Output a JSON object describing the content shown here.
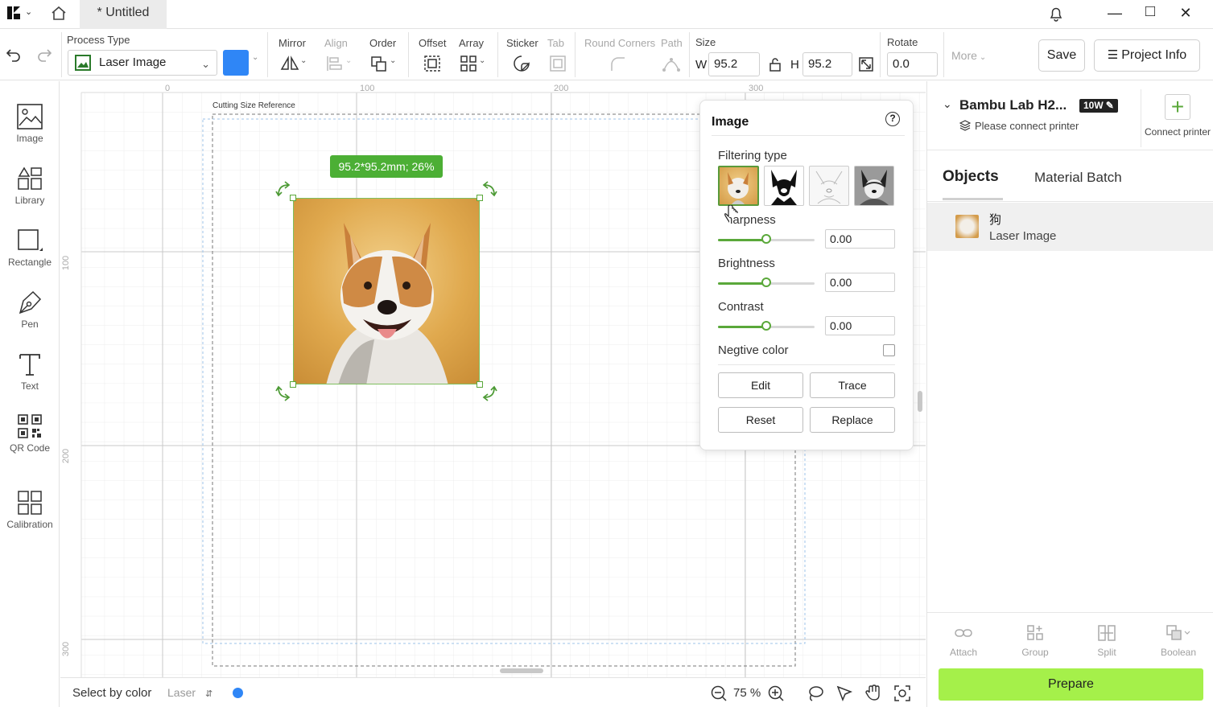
{
  "titlebar": {
    "tab_title": "* Untitled"
  },
  "toolbar": {
    "process_type_label": "Process Type",
    "process_type_value": "Laser Image",
    "mirror": "Mirror",
    "align": "Align",
    "order": "Order",
    "offset": "Offset",
    "array": "Array",
    "sticker": "Sticker",
    "tab": "Tab",
    "round_corners": "Round Corners",
    "path": "Path",
    "size": "Size",
    "w_label": "W",
    "w_value": "95.2",
    "h_label": "H",
    "h_value": "95.2",
    "rotate": "Rotate",
    "rotate_value": "0.0",
    "more": "More",
    "save": "Save",
    "project_info": "Project Info",
    "color": "#2f86f6"
  },
  "left_tools": [
    {
      "label": "Image"
    },
    {
      "label": "Library"
    },
    {
      "label": "Rectangle"
    },
    {
      "label": "Pen"
    },
    {
      "label": "Text"
    },
    {
      "label": "QR Code"
    },
    {
      "label": "Calibration"
    }
  ],
  "canvas": {
    "ruler_top": [
      "0",
      "100",
      "200",
      "300"
    ],
    "ruler_left": [
      "100",
      "200",
      "300"
    ],
    "cutting_ref": "Cutting Size Reference",
    "size_badge": "95.2*95.2mm; 26%"
  },
  "image_panel": {
    "title": "Image",
    "filtering_type": "Filtering type",
    "sharpness": "Sharpness",
    "sharpness_value": "0.00",
    "brightness": "Brightness",
    "brightness_value": "0.00",
    "contrast": "Contrast",
    "contrast_value": "0.00",
    "negative_color": "Negtive color",
    "edit": "Edit",
    "trace": "Trace",
    "reset": "Reset",
    "replace": "Replace"
  },
  "printer": {
    "name": "Bambu Lab H2...",
    "power": "10W",
    "status": "Please connect printer",
    "connect": "Connect printer"
  },
  "right_tabs": {
    "objects": "Objects",
    "material_batch": "Material Batch"
  },
  "objects": [
    {
      "name": "狗",
      "type": "Laser Image"
    }
  ],
  "bottom_actions": {
    "attach": "Attach",
    "group": "Group",
    "split": "Split",
    "boolean": "Boolean",
    "prepare": "Prepare"
  },
  "status": {
    "select_by_color": "Select by color",
    "laser": "Laser",
    "zoom": "75 %",
    "dot_color": "#2f86f6"
  }
}
